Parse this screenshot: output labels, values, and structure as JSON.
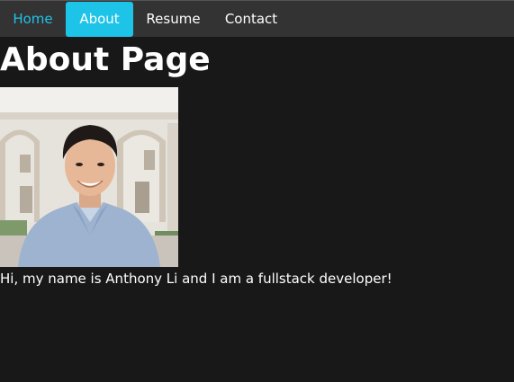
{
  "nav": {
    "items": [
      {
        "label": "Home"
      },
      {
        "label": "About"
      },
      {
        "label": "Resume"
      },
      {
        "label": "Contact"
      }
    ],
    "active": "About",
    "accent_color": "#1ec3e8",
    "background": "#333333"
  },
  "page": {
    "title": "About Page",
    "bio": "Hi, my name is Anthony Li and I am a fullstack developer!",
    "background": "#181818"
  }
}
